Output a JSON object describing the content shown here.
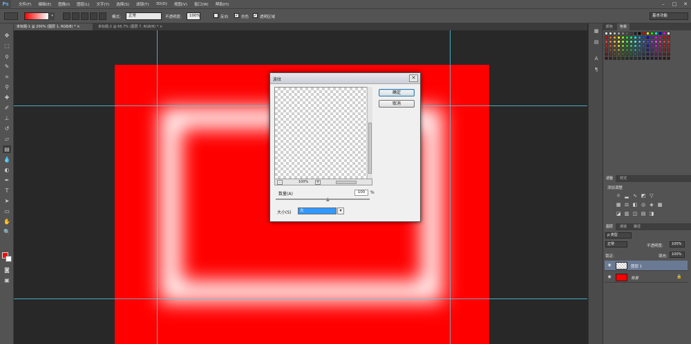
{
  "app": {
    "logo": "Ps",
    "menus": [
      "文件(F)",
      "编辑(E)",
      "图像(I)",
      "图层(L)",
      "文字(Y)",
      "选择(S)",
      "滤镜(T)",
      "3D(D)",
      "视图(V)",
      "窗口(W)",
      "帮助(H)"
    ],
    "window_controls": [
      "–",
      "□",
      "✕"
    ]
  },
  "options_bar": {
    "mode_label": "模式:",
    "mode_value": "正常",
    "opacity_label": "不透明度:",
    "opacity_value": "100%",
    "reverse_label": "反向",
    "dither_label": "仿色",
    "transparency_label": "透明区域",
    "reverse_checked": false,
    "dither_checked": true,
    "transparency_checked": true,
    "workspace": "基本功能"
  },
  "tabs": [
    {
      "label": "未标题-1 @ 200% (图层 1, RGB/8) *",
      "close": "×",
      "active": true
    },
    {
      "label": "未标题-2 @ 66.7% (图层 7, RGB/8) *",
      "close": "×",
      "active": false
    }
  ],
  "colors": {
    "foreground": "#ff0000",
    "background": "#ffffff",
    "canvas_fill": "#ff0000",
    "guide": "#4fd0e8"
  },
  "dialog": {
    "title": "波纹",
    "close": "✕",
    "ok_label": "确定",
    "cancel_label": "取消",
    "zoom_minus": "-",
    "zoom_plus": "+",
    "zoom_value": "100%",
    "amount_label": "数量(A)",
    "amount_value": "100",
    "amount_unit": "%",
    "amount_fraction": 0.55,
    "size_label": "大小(S)",
    "size_value": "大",
    "size_arrow": "▾"
  },
  "panels": {
    "color_tabs": [
      "颜色",
      "色板"
    ],
    "adjust_tabs": [
      "调整",
      "样式"
    ],
    "adjust_title": "添加调整",
    "layer_tabs": [
      "图层",
      "通道",
      "路径"
    ],
    "kind_label": "ρ 类型",
    "blend_mode": "正常",
    "opacity_label": "不透明度:",
    "opacity_value": "100%",
    "lock_label": "锁定:",
    "fill_label": "填充:",
    "fill_value": "100%",
    "layers": [
      {
        "name": "图层 1",
        "selected": true,
        "thumb": "transparent"
      },
      {
        "name": "背景",
        "selected": false,
        "thumb": "#ff0000"
      }
    ]
  },
  "icons": {
    "tools": [
      "move-icon",
      "marquee-icon",
      "lasso-icon",
      "quick-select-icon",
      "crop-icon",
      "eyedropper-icon",
      "healing-icon",
      "brush-icon",
      "stamp-icon",
      "history-brush-icon",
      "eraser-icon",
      "gradient-icon",
      "blur-icon",
      "dodge-icon",
      "pen-icon",
      "type-icon",
      "path-select-icon",
      "rectangle-icon",
      "hand-icon",
      "zoom-icon"
    ]
  }
}
